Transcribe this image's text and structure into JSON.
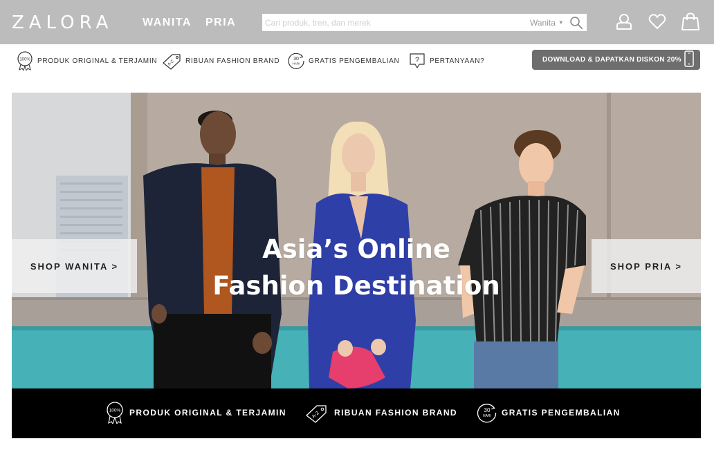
{
  "header": {
    "logo": "ZALORA",
    "nav": [
      "WANITA",
      "PRIA"
    ],
    "search": {
      "placeholder": "Cari produk, tren, dan merek",
      "department": "Wanita"
    },
    "icons": [
      "search-icon",
      "account-icon",
      "wishlist-heart-icon",
      "shopping-bag-icon"
    ]
  },
  "usp_bar": {
    "items": [
      {
        "icon": "original-badge-icon",
        "icon_text": "100%",
        "label": "PRODUK ORIGINAL & TERJAMIN"
      },
      {
        "icon": "brand-tag-icon",
        "icon_text": "A-Z",
        "label": "RIBUAN FASHION BRAND"
      },
      {
        "icon": "return-30-days-icon",
        "icon_text": "30 HARI",
        "label": "GRATIS PENGEMBALIAN"
      },
      {
        "icon": "question-icon",
        "icon_text": "?",
        "label": "PERTANYAAN?"
      }
    ],
    "download_label": "DOWNLOAD & DAPATKAN DISKON 20%"
  },
  "hero": {
    "headline_line1": "Asia’s Online",
    "headline_line2": "Fashion Destination",
    "shop_wanita": "SHOP WANITA >",
    "shop_pria": "SHOP PRIA >"
  },
  "strip": {
    "items": [
      {
        "icon": "original-badge-icon",
        "icon_text": "100%",
        "label": "PRODUK ORIGINAL & TERJAMIN"
      },
      {
        "icon": "brand-tag-icon",
        "icon_text": "A-Z",
        "label": "RIBUAN FASHION BRAND"
      },
      {
        "icon": "return-30-days-icon",
        "icon_text": "30 HARI",
        "label": "GRATIS PENGEMBALIAN"
      }
    ]
  },
  "colors": {
    "header_bg": "#bcbcbc",
    "download_button": "#6e6e6e",
    "strip_bg": "#000000",
    "hero_blue": "#2f3fa8"
  }
}
